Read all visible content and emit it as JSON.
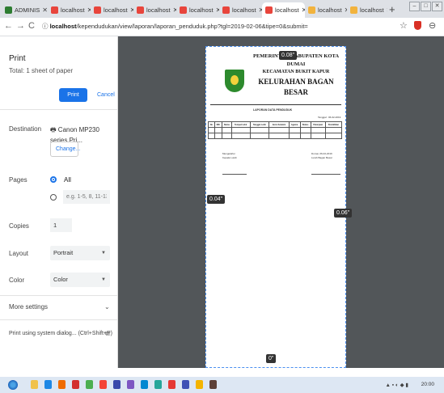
{
  "tabs": [
    {
      "label": "ADMINIS",
      "favicon_color": "#2e7d32",
      "active": false
    },
    {
      "label": "localhost",
      "favicon_color": "#e8453c",
      "active": false
    },
    {
      "label": "localhost",
      "favicon_color": "#e8453c",
      "active": false
    },
    {
      "label": "localhost",
      "favicon_color": "#e8453c",
      "active": false
    },
    {
      "label": "localhost",
      "favicon_color": "#e8453c",
      "active": false
    },
    {
      "label": "localhost",
      "favicon_color": "#e8453c",
      "active": false
    },
    {
      "label": "localhost",
      "favicon_color": "#e8453c",
      "active": true
    },
    {
      "label": "localhost",
      "favicon_color": "#f2b33d",
      "active": false
    },
    {
      "label": "localhost",
      "favicon_color": "#f2b33d",
      "active": false
    }
  ],
  "address": {
    "host": "localhost",
    "path": "/kependudukan/view/laporan/laporan_penduduk.php?tgl=2019-02-06&tipe=0&submit="
  },
  "print": {
    "title": "Print",
    "total": "Total: 1 sheet of paper",
    "print_label": "Print",
    "cancel_label": "Cancel",
    "destination_label": "Destination",
    "destination_value": "Canon MP230 series Pri...",
    "change_label": "Change...",
    "pages_label": "Pages",
    "pages_all": "All",
    "pages_placeholder": "e.g. 1-5, 8, 11-13",
    "copies_label": "Copies",
    "copies_value": "1",
    "layout_label": "Layout",
    "layout_value": "Portrait",
    "color_label": "Color",
    "color_value": "Color",
    "more_settings": "More settings",
    "system_dialog": "Print using system dialog... (Ctrl+Shift+P)"
  },
  "preview": {
    "margin_top": "0.08\"",
    "margin_left": "0.04\"",
    "margin_right": "0.06\"",
    "margin_bottom": "0\"",
    "doc": {
      "line1": "PEMERINTAH KABUPATEN KOTA",
      "line2": "DUMAI",
      "line3": "KECAMATAN BUKIT KAPUR",
      "line4": "KELURAHAN BAGAN",
      "line5": "BESAR",
      "report_title": "LAPORAN DATA PENDUDUK",
      "date": "Tanggal : 06-02-2019",
      "table_headers": [
        "No",
        "NIK",
        "Nama",
        "Tempat Lahir",
        "Tanggal Lahir",
        "Jenis Kelamin",
        "Agama",
        "Status",
        "Pekerjaan",
        "Pendidikan"
      ],
      "sign_left_1": "Mengetahui",
      "sign_left_2": "Kepala Lurah",
      "sign_right_1": "Dumai, 06-02-2019",
      "sign_right_2": "Lurah Bagan Besar"
    }
  },
  "taskbar": {
    "clock": "20:00"
  }
}
